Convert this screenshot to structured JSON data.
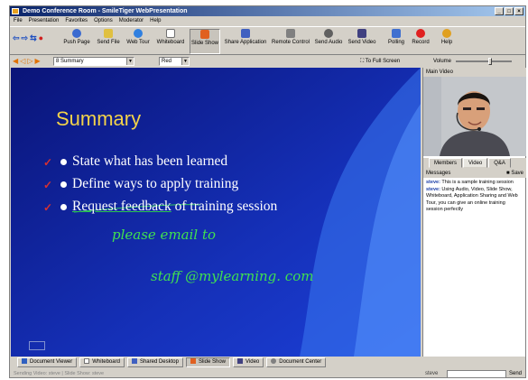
{
  "window": {
    "title": "Demo Conference Room - SmileTiger WebPresentation",
    "controls": [
      "_",
      "□",
      "×"
    ]
  },
  "menu": [
    "File",
    "Presentation",
    "Favorites",
    "Options",
    "Moderator",
    "Help"
  ],
  "toolbar": {
    "nav": [
      "⇦",
      "⇨",
      "⇆",
      "●"
    ],
    "buttons": [
      {
        "label": "Push Page",
        "icon": "push-page-icon",
        "color": "#3a6ad0"
      },
      {
        "label": "Send File",
        "icon": "send-file-icon",
        "color": "#e0c040"
      },
      {
        "label": "Web Tour",
        "icon": "web-tour-icon",
        "color": "#3080e0"
      },
      {
        "label": "Whiteboard",
        "icon": "whiteboard-icon",
        "color": "#707070"
      },
      {
        "label": "Slide Show",
        "icon": "slide-show-icon",
        "color": "#e06020"
      },
      {
        "label": "Share Application",
        "icon": "share-application-icon",
        "color": "#4060c0"
      },
      {
        "label": "Remote Control",
        "icon": "remote-control-icon",
        "color": "#808080"
      },
      {
        "label": "Send Audio",
        "icon": "send-audio-icon",
        "color": "#606060"
      },
      {
        "label": "Send Video",
        "icon": "send-video-icon",
        "color": "#404080"
      },
      {
        "label": "Polling",
        "icon": "polling-icon",
        "color": "#4070d0"
      },
      {
        "label": "Record",
        "icon": "record-icon",
        "color": "#e02020"
      },
      {
        "label": "Help",
        "icon": "help-icon",
        "color": "#e0a020"
      }
    ]
  },
  "slidebar": {
    "arrows": [
      "◀",
      "◁",
      "▷",
      "▶"
    ],
    "slide_select": "8 Summary",
    "pen_color": "Red",
    "full_screen": "To Full Screen",
    "volume": "Volume"
  },
  "slide": {
    "title": "Summary",
    "bullets": [
      "State what has been learned",
      "Define ways to apply training",
      "Request feedback",
      " of training session"
    ],
    "check": "✓",
    "handwriting": [
      "please email to",
      "staff @mylearning. com"
    ],
    "colors": {
      "title": "#f2d24a",
      "ink": "#40e050",
      "bg": "#0c1a8a"
    }
  },
  "right": {
    "main_video": "Main Video",
    "tabs": [
      "Members",
      "Video",
      "Q&A"
    ],
    "messages_label": "Messages",
    "save_label": "Save",
    "messages": [
      {
        "who": "steve:",
        "text": " This is a sample training session"
      },
      {
        "who": "steve:",
        "text": " Using Audio, Video, Slide Show, Whiteboard, Application Sharing and Web Tour, you can give an online training session perfectly"
      }
    ]
  },
  "bottom_tabs": [
    "Document Viewer",
    "Whiteboard",
    "Shared Desktop",
    "Slide Show",
    "Video",
    "Document Center"
  ],
  "status": {
    "text": "Sending Video: steve  |  Slide Show: steve",
    "chat_user": "steve",
    "send": "Send"
  }
}
